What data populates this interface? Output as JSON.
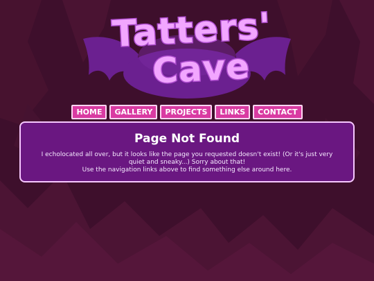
{
  "site": {
    "logo_line1": "Tatters'",
    "logo_line2": "Cave"
  },
  "nav": {
    "items": [
      {
        "label": "HOME"
      },
      {
        "label": "GALLERY"
      },
      {
        "label": "PROJECTS"
      },
      {
        "label": "LINKS"
      },
      {
        "label": "CONTACT"
      }
    ]
  },
  "error": {
    "heading": "Page Not Found",
    "message_line1": "I echolocated all over, but it looks like the page you requested doesn't exist! (Or it's just very quiet and sneaky...) Sorry about that!",
    "message_line2": "Use the navigation links above to find something else around here."
  },
  "colors": {
    "background": "#3e0f2c",
    "accent_pink": "#d93ba2",
    "panel_purple": "#6a1781",
    "logo_pink": "#f2a6ff",
    "bat_purple": "#6b2090"
  },
  "icons": {
    "logo_mascot": "bat-wings-icon"
  }
}
